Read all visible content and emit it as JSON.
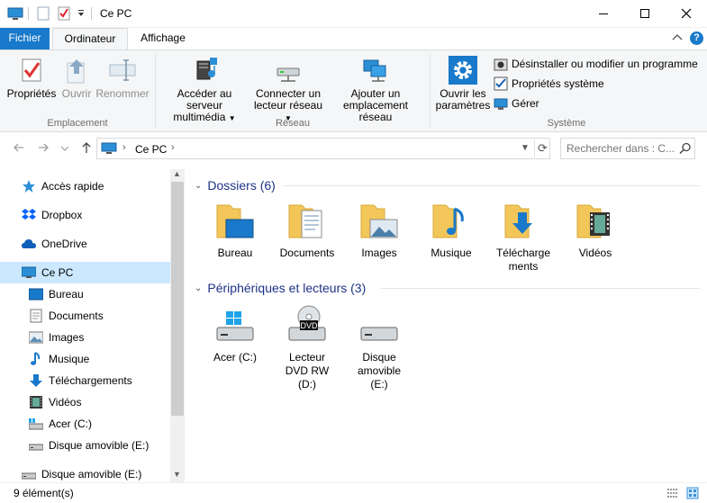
{
  "window": {
    "title": "Ce PC"
  },
  "tabs": {
    "file": "Fichier",
    "computer": "Ordinateur",
    "view": "Affichage"
  },
  "ribbon": {
    "emplacement": {
      "label": "Emplacement",
      "properties": "Propriétés",
      "open": "Ouvrir",
      "rename": "Renommer"
    },
    "reseau": {
      "label": "Réseau",
      "media_line1": "Accéder au serveur",
      "media_line2": "multimédia",
      "map_line1": "Connecter un",
      "map_line2": "lecteur réseau",
      "add_line1": "Ajouter un",
      "add_line2": "emplacement réseau"
    },
    "systeme": {
      "label": "Système",
      "settings_line1": "Ouvrir les",
      "settings_line2": "paramètres",
      "uninstall": "Désinstaller ou modifier un programme",
      "sysprops": "Propriétés système",
      "manage": "Gérer"
    }
  },
  "address": {
    "crumb": "Ce PC",
    "search_placeholder": "Rechercher dans : C..."
  },
  "nav": [
    {
      "label": "Accès rapide",
      "icon": "star-icon"
    },
    {
      "label": "Dropbox",
      "icon": "dropbox-icon"
    },
    {
      "label": "OneDrive",
      "icon": "cloud-icon"
    },
    {
      "label": "Ce PC",
      "icon": "computer-icon"
    },
    {
      "label": "Bureau",
      "icon": "desktop-icon"
    },
    {
      "label": "Documents",
      "icon": "document-icon"
    },
    {
      "label": "Images",
      "icon": "picture-icon"
    },
    {
      "label": "Musique",
      "icon": "music-icon"
    },
    {
      "label": "Téléchargements",
      "icon": "download-icon"
    },
    {
      "label": "Vidéos",
      "icon": "video-icon"
    },
    {
      "label": "Acer (C:)",
      "icon": "drive-icon"
    },
    {
      "label": "Disque amovible (E:)",
      "icon": "removable-drive-icon"
    },
    {
      "label": "Disque amovible (E:)",
      "icon": "removable-drive-icon"
    }
  ],
  "groups": {
    "folders": "Dossiers (6)",
    "devices": "Périphériques et lecteurs (3)"
  },
  "folders": [
    {
      "line1": "Bureau",
      "line2": ""
    },
    {
      "line1": "Documents",
      "line2": ""
    },
    {
      "line1": "Images",
      "line2": ""
    },
    {
      "line1": "Musique",
      "line2": ""
    },
    {
      "line1": "Télécharge",
      "line2": "ments"
    },
    {
      "line1": "Vidéos",
      "line2": ""
    }
  ],
  "devices": [
    {
      "line1": "Acer (C:)",
      "line2": "",
      "line3": ""
    },
    {
      "line1": "Lecteur",
      "line2": "DVD RW",
      "line3": "(D:)"
    },
    {
      "line1": "Disque",
      "line2": "amovible",
      "line3": "(E:)"
    }
  ],
  "dvd_badge": "DVD",
  "status": {
    "count": "9 élément(s)"
  },
  "colors": {
    "accent": "#1979ca",
    "selection": "#cce8ff",
    "group_header": "#1e3287",
    "folder": "#f3c65a"
  }
}
